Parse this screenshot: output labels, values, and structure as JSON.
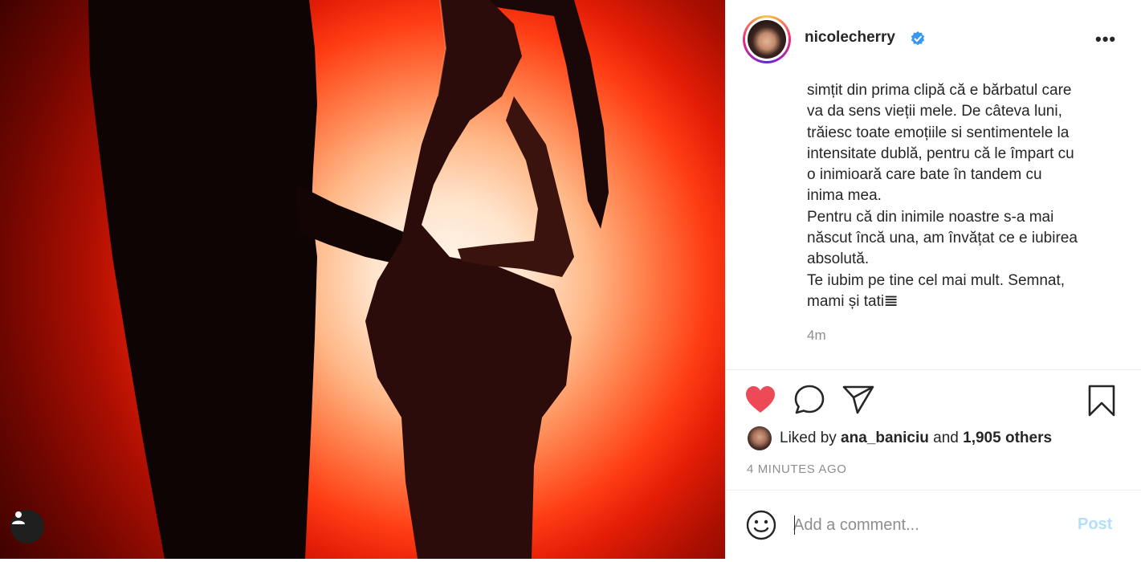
{
  "post": {
    "username": "nicolecherry",
    "more_icon": "•••",
    "caption_lines": [
      "simțit din prima clipă că e bărbatul care",
      "va da sens vieții mele. De câteva luni,",
      "trăiesc toate emoțiile si sentimentele la",
      "intensitate dublă, pentru că le împart cu",
      "o inimioară care bate în tandem cu",
      "inima mea.",
      "Pentru că din inimile noastre s-a mai",
      "născut încă una, am învățat ce e iubirea",
      "absolută.",
      "Te iubim pe tine cel mai mult. Semnat,",
      "mami și tati𝌆"
    ],
    "caption_age": "4m",
    "likes": {
      "prefix": "Liked by ",
      "liker": "ana_baniciu",
      "middle": " and ",
      "others": "1,905 others"
    },
    "timestamp": "4 MINUTES AGO",
    "comment": {
      "placeholder": "Add a comment...",
      "post_label": "Post"
    }
  },
  "colors": {
    "like_red": "#ed4956",
    "verified_blue": "#3897f0",
    "post_disabled": "#b2dffc",
    "muted_text": "#8e8e8e"
  },
  "icons": [
    "heart-icon",
    "comment-icon",
    "share-icon",
    "bookmark-icon",
    "emoji-icon",
    "user-tag-icon",
    "verified-badge-icon",
    "more-options-icon"
  ]
}
